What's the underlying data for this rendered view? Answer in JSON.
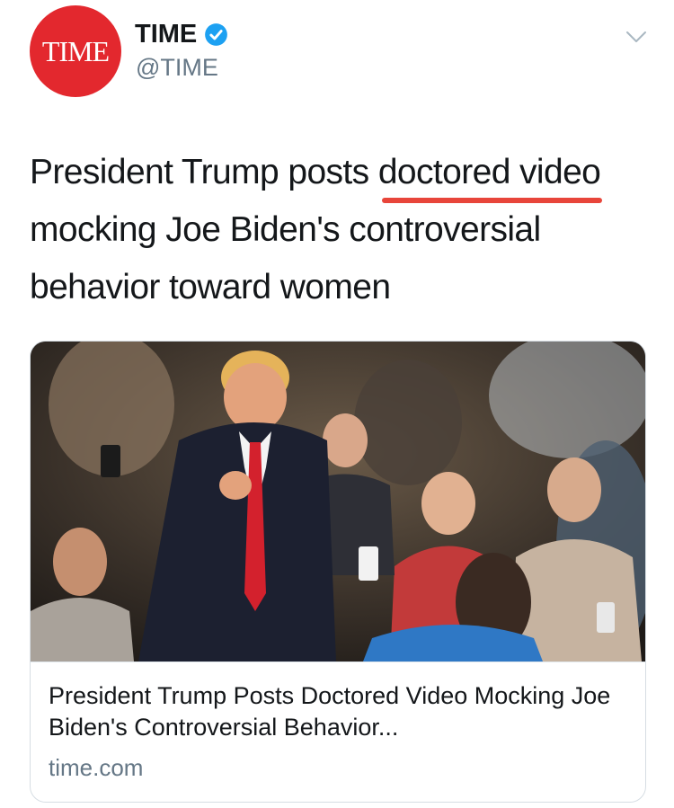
{
  "author": {
    "avatar_text": "TIME",
    "display_name": "TIME",
    "handle": "@TIME",
    "verified": true,
    "avatar_color": "#e3282e",
    "verified_color": "#1da1f2"
  },
  "tweet": {
    "text_before": "President Trump posts ",
    "text_highlight": "doctored video",
    "text_after": " mocking Joe Biden's controversial behavior toward women",
    "highlight_underline_color": "#e8453a"
  },
  "card": {
    "title": "President Trump Posts Doctored Video Mocking Joe Biden's Controversial Behavior...",
    "domain": "time.com"
  },
  "icons": {
    "menu": "chevron-down-icon",
    "verified": "verified-badge-icon"
  }
}
